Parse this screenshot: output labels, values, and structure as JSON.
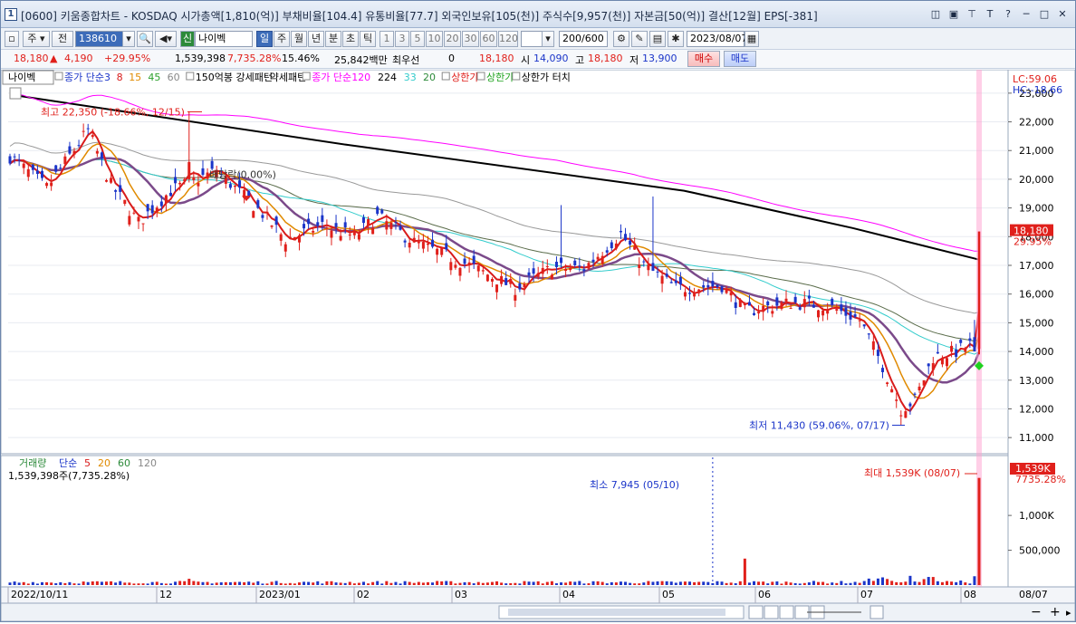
{
  "window": {
    "number": "1",
    "title": "[0600] 키움종합차트 - KOSDAQ 시가총액[1,810(억)] 부채비율[104.4] 유통비율[77.7] 외국인보유[105(천)] 주식수[9,957(천)] 자본금[50(억)] 결산[12월] EPS[-381]"
  },
  "toolbar1": {
    "market": "주",
    "period_label": "전",
    "code": "138610",
    "stock_badge": "신",
    "stock_name": "나이벡",
    "periods": [
      "일",
      "주",
      "월",
      "년",
      "분",
      "초",
      "틱"
    ],
    "minutes": [
      "1",
      "3",
      "5",
      "10",
      "20",
      "30",
      "60",
      "120"
    ],
    "count": "200/600",
    "date": "2023/08/07"
  },
  "toolbar2": {
    "price": "18,180",
    "change": "4,190",
    "change_pct": "+29.95%",
    "volume": "1,539,398",
    "vol_ratio": "7,735.28%",
    "turnover": "15.46%",
    "amount": "25,842백만",
    "pref_label": "최우선",
    "pref_val": "0",
    "ask": "18,180",
    "open_label": "시",
    "open": "14,090",
    "high_label": "고",
    "high": "18,180",
    "low_label": "저",
    "low": "13,900",
    "buy": "매수",
    "sell": "매도"
  },
  "legend": {
    "name": "나이벡",
    "ma_label": "종가 단순",
    "ma_periods": [
      "3",
      "8",
      "15",
      "45",
      "60"
    ],
    "pattern": "150억봉 강세패턴",
    "pattern2": "약세패턴",
    "ma2_label": "종가 단순",
    "ma2_periods": [
      "120",
      "224",
      "33",
      "20"
    ],
    "upper": "상한가",
    "upper2": "상한가",
    "upper_touch": "상한가 터치"
  },
  "price_axis": {
    "ticks": [
      "23,000",
      "22,000",
      "21,000",
      "20,000",
      "19,000",
      "18,000",
      "17,000",
      "16,000",
      "15,000",
      "14,000",
      "13,000",
      "12,000",
      "11,000"
    ],
    "lc": "LC:59.06",
    "hc": "HC:-18.66",
    "last": "18,180",
    "last_pct": "29.95%"
  },
  "annotations": {
    "high": "최고 22,350 (-18.66%, 12/15)",
    "low": "최저 11,430 (59.06%, 07/17)",
    "dividend": "배당락(0.00%)",
    "vol_min": "최소 7,945 (05/10)",
    "vol_max": "최대 1,539K (08/07)"
  },
  "volume_legend": {
    "label": "거래량",
    "ma_label": "단순",
    "periods": [
      "5",
      "20",
      "60",
      "120"
    ],
    "current": "1,539,398주(7,735.28%)"
  },
  "volume_axis": {
    "ticks": [
      "1,000K",
      "500,000"
    ],
    "last": "1,539K",
    "last_pct": "7735.28%"
  },
  "x_axis": {
    "labels": [
      "2022/10/11",
      "12",
      "2023/01",
      "02",
      "03",
      "04",
      "05",
      "06",
      "07",
      "08"
    ],
    "right": "08/07"
  },
  "colors": {
    "up": "#e0201b",
    "down": "#1b35c9",
    "ma3": "#d81b1b",
    "ma8": "#e08a00",
    "ma15": "#2ca02c",
    "ma45": "#7b4a8a",
    "ma60": "#5a6c4a",
    "ma120": "#ff00ff",
    "ma224": "#000000"
  },
  "chart_data": {
    "type": "candlestick",
    "x_range": [
      "2022/10/11",
      "2023/08/07"
    ],
    "ylim": [
      10500,
      23500
    ],
    "key_points": [
      {
        "date": "12/15",
        "price": 22350,
        "label": "high"
      },
      {
        "date": "07/17",
        "price": 11430,
        "label": "low"
      },
      {
        "date": "08/07",
        "price": 18180,
        "label": "last"
      }
    ],
    "ma224_path": [
      [
        0,
        22950
      ],
      [
        40,
        21200
      ],
      [
        80,
        19600
      ],
      [
        100,
        18300
      ],
      [
        115,
        17200
      ]
    ],
    "volume_max": 1539398
  }
}
